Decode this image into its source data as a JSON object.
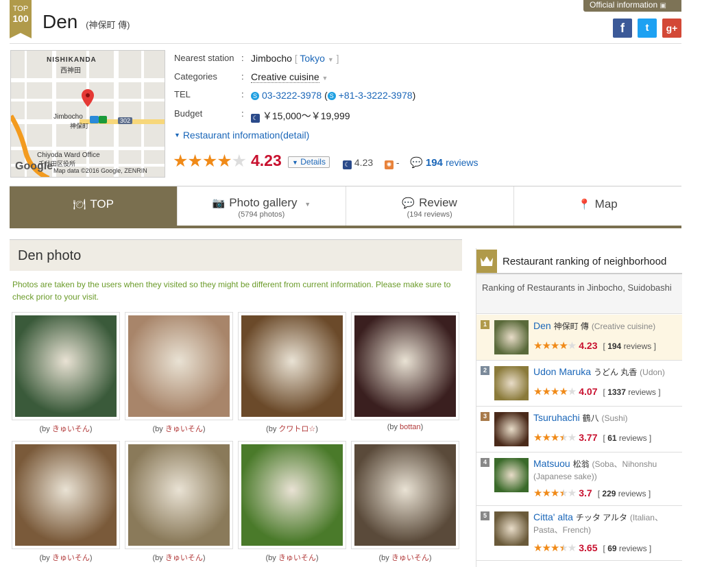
{
  "badge": {
    "line1": "TOP",
    "line2": "100"
  },
  "restaurant": {
    "name": "Den",
    "name_jp": "(神保町 傳)"
  },
  "official_label": "Official information",
  "social": {
    "facebook": "f",
    "twitter": "t",
    "google": "g+"
  },
  "map": {
    "area_en": "NISHIKANDA",
    "area_jp": "西神田",
    "station": "Jimbocho",
    "station_jp": "神保町",
    "route": "302",
    "office": "Chiyoda Ward Office",
    "office_jp": "千代田区役所",
    "logo": "Google",
    "attribution": "Map data ©2016 Google, ZENRIN"
  },
  "info": {
    "station_label": "Nearest station",
    "station_value": "Jimbocho",
    "station_link": "Tokyo",
    "category_label": "Categories",
    "category_value": "Creative cuisine",
    "tel_label": "TEL",
    "tel_value": "03-3222-3978",
    "tel_intl": "+81-3-3222-3978",
    "budget_label": "Budget",
    "budget_value": "￥15,000～￥19,999",
    "detail_link": "Restaurant information(detail)",
    "colon": ":"
  },
  "rating": {
    "score": "4.23",
    "stars_value": 4.23,
    "details_label": "Details",
    "dinner_score": "4.23",
    "lunch_score": "-",
    "review_count": "194",
    "reviews_label": "reviews"
  },
  "tabs": [
    {
      "label": "TOP",
      "count": ""
    },
    {
      "label": "Photo gallery",
      "count": "(5794 photos)"
    },
    {
      "label": "Review",
      "count": "(194 reviews)"
    },
    {
      "label": "Map",
      "count": ""
    }
  ],
  "photos": {
    "heading": "Den photo",
    "note": "Photos are taken by the users when they visited so they might be different from current information. Please make sure to check prior to your visit.",
    "by_prefix": "(by ",
    "by_suffix": ")",
    "items": [
      {
        "user": "きゅいそん",
        "color": "#3a5a3a"
      },
      {
        "user": "きゅいそん",
        "color": "#a8856a"
      },
      {
        "user": "クワトロ☆",
        "color": "#6b4a2a"
      },
      {
        "user": "bottan",
        "color": "#3a1f1f"
      },
      {
        "user": "きゅいそん",
        "color": "#7a5a3a"
      },
      {
        "user": "きゅいそん",
        "color": "#8a7a5a"
      },
      {
        "user": "きゅいそん",
        "color": "#4a7a2a"
      },
      {
        "user": "きゅいそん",
        "color": "#5a4a3a"
      }
    ]
  },
  "ranking": {
    "title": "Restaurant ranking of neighborhood",
    "subtitle": "Ranking of Restaurants in Jinbocho, Suidobashi",
    "items": [
      {
        "num": "1",
        "name": "Den",
        "jp": "神保町 傳",
        "cat": "(Creative cuisine)",
        "score": "4.23",
        "reviews": "194",
        "stars": 4.23,
        "color": "#5a6a3a"
      },
      {
        "num": "2",
        "name": "Udon Maruka",
        "jp": "うどん 丸香",
        "cat": "(Udon)",
        "score": "4.07",
        "reviews": "1337",
        "stars": 4.07,
        "color": "#8a7a3a"
      },
      {
        "num": "3",
        "name": "Tsuruhachi",
        "jp": "鶴八",
        "cat": "(Sushi)",
        "score": "3.77",
        "reviews": "61",
        "stars": 3.77,
        "color": "#4a2a1a"
      },
      {
        "num": "4",
        "name": "Matsuou",
        "jp": "松翁",
        "cat": "(Soba、Nihonshu (Japanese sake))",
        "score": "3.7",
        "reviews": "229",
        "stars": 3.7,
        "color": "#3a6a2a"
      },
      {
        "num": "5",
        "name": "Citta' alta",
        "jp": "チッタ アルタ",
        "cat": "(Italian、Pasta、French)",
        "score": "3.65",
        "reviews": "69",
        "stars": 3.65,
        "color": "#6a5a3a"
      }
    ],
    "reviews_label": "reviews",
    "bracket_open": "[",
    "bracket_close": "]"
  }
}
